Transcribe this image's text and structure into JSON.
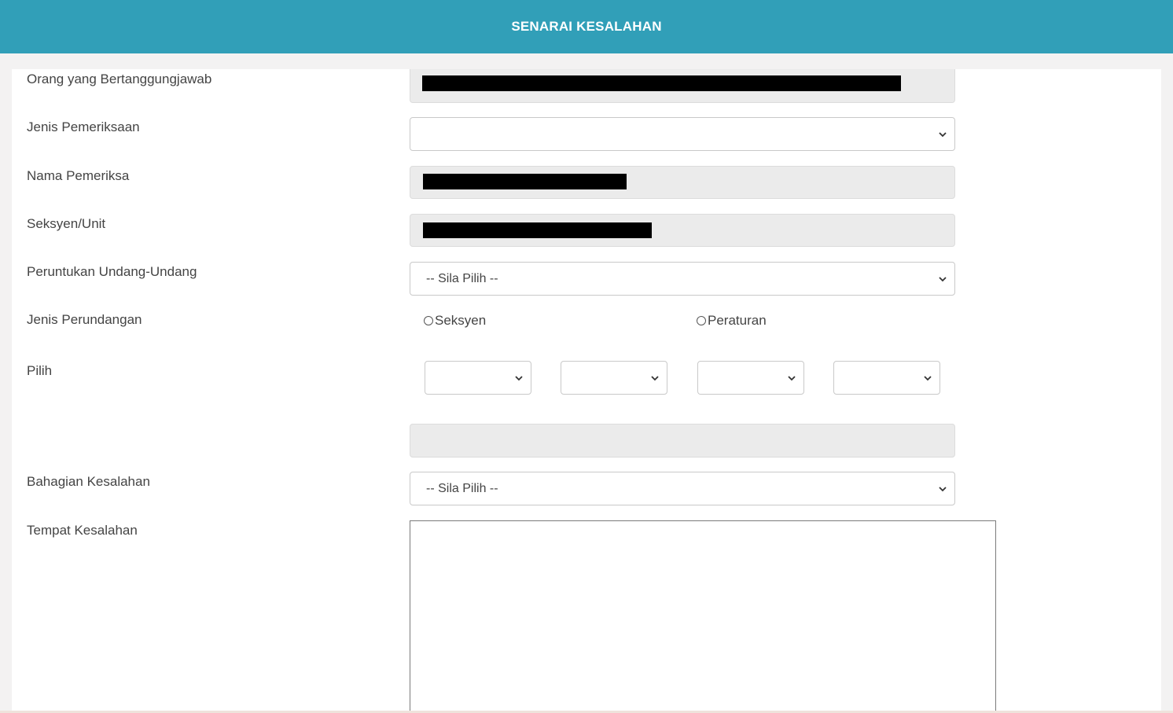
{
  "header": {
    "title": "SENARAI KESALAHAN"
  },
  "form": {
    "orang_label": "Orang yang Bertanggungjawab",
    "jenis_pemeriksaan_label": "Jenis Pemeriksaan",
    "jenis_pemeriksaan_value": "",
    "nama_pemeriksa_label": "Nama Pemeriksa",
    "seksyen_unit_label": "Seksyen/Unit",
    "peruntukan_label": "Peruntukan Undang-Undang",
    "peruntukan_value": "-- Sila Pilih --",
    "jenis_perundangan_label": "Jenis Perundangan",
    "radio_seksyen": "Seksyen",
    "radio_peraturan": "Peraturan",
    "pilih_label": "Pilih",
    "bahagian_label": "Bahagian Kesalahan",
    "bahagian_value": "-- Sila Pilih --",
    "tempat_label": "Tempat Kesalahan"
  },
  "icons": {
    "select_arrow": "chevron-down-icon",
    "radio": "radio-unchecked-icon"
  },
  "colors": {
    "header_bg": "#319fb8",
    "page_bg": "#f3f2f2",
    "readonly_bg": "#ebebeb"
  }
}
